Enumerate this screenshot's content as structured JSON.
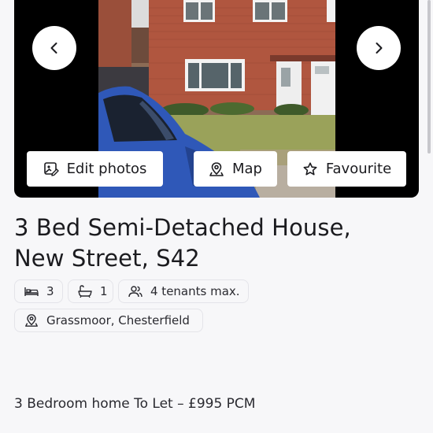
{
  "gallery": {
    "prev_label": "Previous photo",
    "next_label": "Next photo",
    "actions": {
      "edit": "Edit photos",
      "map": "Map",
      "favourite": "Favourite"
    }
  },
  "listing": {
    "title_line1": "3 Bed Semi-Detached House,",
    "title_line2": "New Street, S42",
    "bedrooms": "3",
    "bathrooms": "1",
    "tenants": "4 tenants max.",
    "location": "Grassmoor, Chesterfield",
    "description": "3 Bedroom home To Let – £995 PCM"
  },
  "icons": {
    "prev": "chevron-left-icon",
    "next": "chevron-right-icon",
    "edit": "edit-photo-icon",
    "map": "map-pin-icon",
    "favourite": "star-icon",
    "bed": "bed-icon",
    "bath": "bath-icon",
    "tenants": "people-icon",
    "location": "map-pin-icon"
  },
  "colors": {
    "background": "#f7f7f9",
    "text": "#1b1b1f",
    "gallery_bg": "#000000",
    "button_bg": "#ffffff"
  }
}
